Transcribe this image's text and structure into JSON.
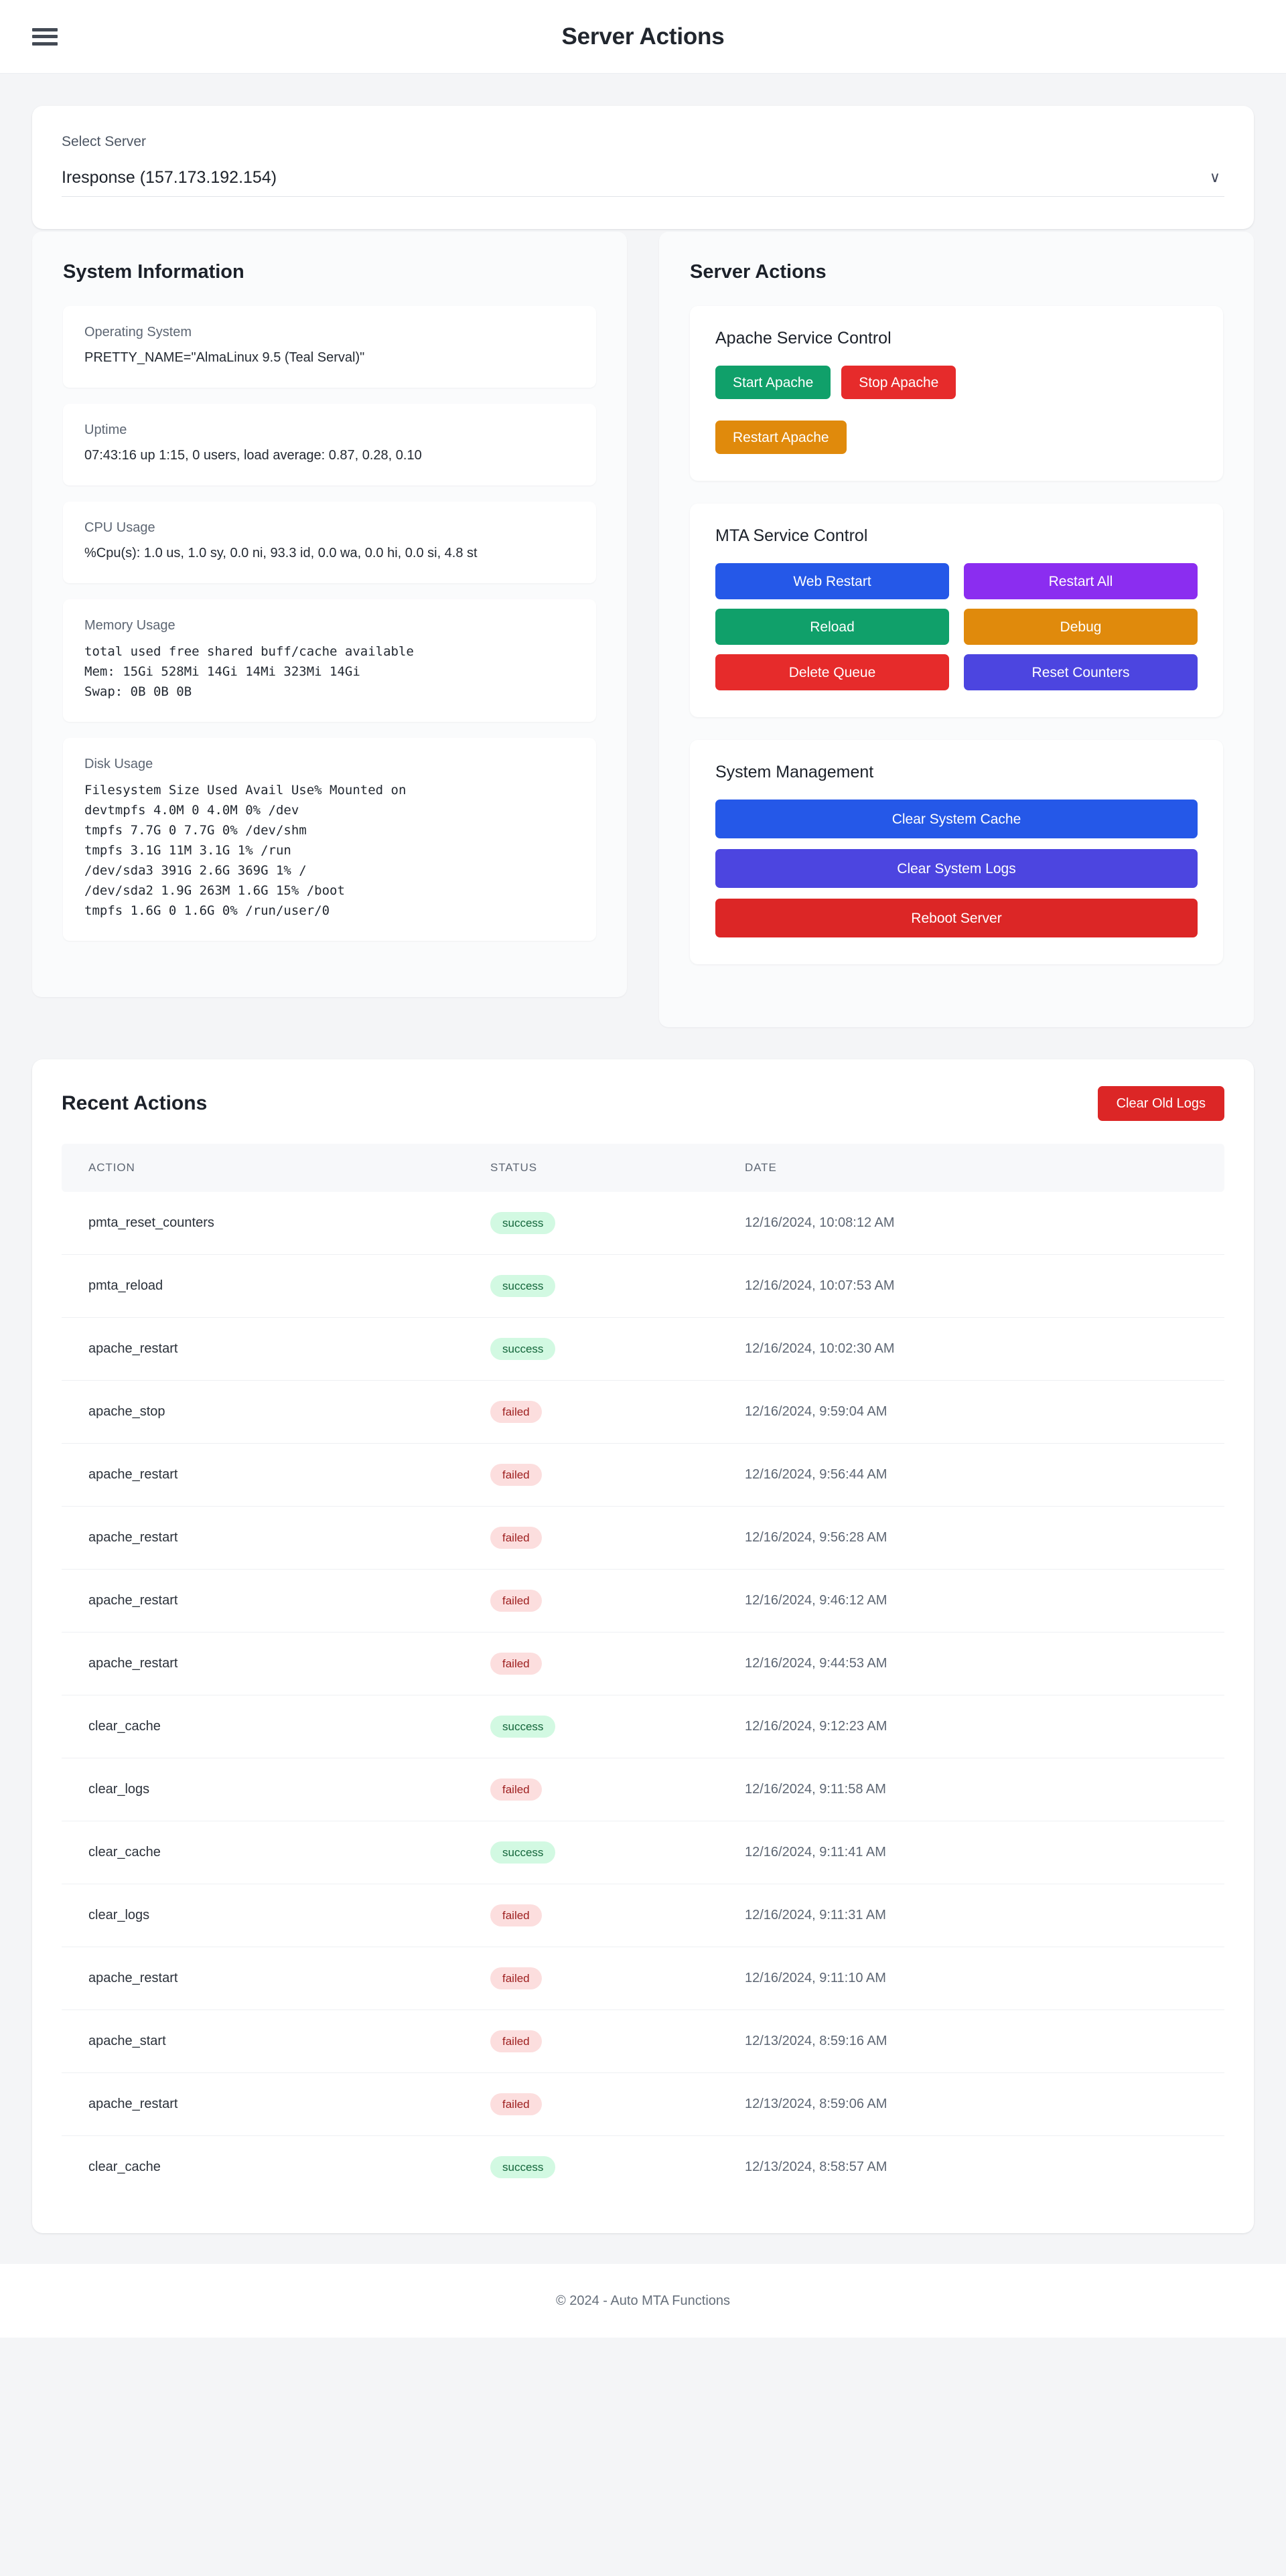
{
  "header": {
    "title": "Server Actions",
    "menu_icon": "hamburger-menu-icon"
  },
  "server_select": {
    "label": "Select Server",
    "value": "Iresponse (157.173.192.154)",
    "caret_icon": "chevron-down-icon"
  },
  "system_information": {
    "title": "System Information",
    "blocks": [
      {
        "label": "Operating System",
        "value": "PRETTY_NAME=\"AlmaLinux 9.5 (Teal Serval)\"",
        "mono": false
      },
      {
        "label": "Uptime",
        "value": "07:43:16 up 1:15, 0 users, load average: 0.87, 0.28, 0.10",
        "mono": false
      },
      {
        "label": "CPU Usage",
        "value": "%Cpu(s): 1.0 us, 1.0 sy, 0.0 ni, 93.3 id, 0.0 wa, 0.0 hi, 0.0 si, 4.8 st",
        "mono": false
      },
      {
        "label": "Memory Usage",
        "value": "total used free shared buff/cache available\nMem: 15Gi 528Mi 14Gi 14Mi 323Mi 14Gi\nSwap: 0B 0B 0B",
        "mono": true
      },
      {
        "label": "Disk Usage",
        "value": "Filesystem Size Used Avail Use% Mounted on\ndevtmpfs 4.0M 0 4.0M 0% /dev\ntmpfs 7.7G 0 7.7G 0% /dev/shm\ntmpfs 3.1G 11M 3.1G 1% /run\n/dev/sda3 391G 2.6G 369G 1% /\n/dev/sda2 1.9G 263M 1.6G 15% /boot\ntmpfs 1.6G 0 1.6G 0% /run/user/0",
        "mono": true
      }
    ]
  },
  "server_actions": {
    "title": "Server Actions",
    "apache": {
      "title": "Apache Service Control",
      "buttons": [
        {
          "label": "Start Apache",
          "color": "#10a06a"
        },
        {
          "label": "Stop Apache",
          "color": "#e62b2b"
        },
        {
          "label": "Restart Apache",
          "color": "#e08a0c"
        }
      ]
    },
    "mta": {
      "title": "MTA Service Control",
      "buttons": [
        {
          "label": "Web Restart",
          "color": "#2558e8"
        },
        {
          "label": "Restart All",
          "color": "#8b2df0"
        },
        {
          "label": "Reload",
          "color": "#10a06a"
        },
        {
          "label": "Debug",
          "color": "#e08a0c"
        },
        {
          "label": "Delete Queue",
          "color": "#e62b2b"
        },
        {
          "label": "Reset Counters",
          "color": "#4c45e0"
        }
      ]
    },
    "system_management": {
      "title": "System Management",
      "buttons": [
        {
          "label": "Clear System Cache",
          "color": "#2558e8"
        },
        {
          "label": "Clear System Logs",
          "color": "#4c45e0"
        },
        {
          "label": "Reboot Server",
          "color": "#dc2626"
        }
      ]
    }
  },
  "recent_actions": {
    "title": "Recent Actions",
    "clear_logs_label": "Clear Old Logs",
    "columns": [
      "ACTION",
      "STATUS",
      "DATE"
    ],
    "rows": [
      {
        "action": "pmta_reset_counters",
        "status": "success",
        "date": "12/16/2024, 10:08:12 AM"
      },
      {
        "action": "pmta_reload",
        "status": "success",
        "date": "12/16/2024, 10:07:53 AM"
      },
      {
        "action": "apache_restart",
        "status": "success",
        "date": "12/16/2024, 10:02:30 AM"
      },
      {
        "action": "apache_stop",
        "status": "failed",
        "date": "12/16/2024, 9:59:04 AM"
      },
      {
        "action": "apache_restart",
        "status": "failed",
        "date": "12/16/2024, 9:56:44 AM"
      },
      {
        "action": "apache_restart",
        "status": "failed",
        "date": "12/16/2024, 9:56:28 AM"
      },
      {
        "action": "apache_restart",
        "status": "failed",
        "date": "12/16/2024, 9:46:12 AM"
      },
      {
        "action": "apache_restart",
        "status": "failed",
        "date": "12/16/2024, 9:44:53 AM"
      },
      {
        "action": "clear_cache",
        "status": "success",
        "date": "12/16/2024, 9:12:23 AM"
      },
      {
        "action": "clear_logs",
        "status": "failed",
        "date": "12/16/2024, 9:11:58 AM"
      },
      {
        "action": "clear_cache",
        "status": "success",
        "date": "12/16/2024, 9:11:41 AM"
      },
      {
        "action": "clear_logs",
        "status": "failed",
        "date": "12/16/2024, 9:11:31 AM"
      },
      {
        "action": "apache_restart",
        "status": "failed",
        "date": "12/16/2024, 9:11:10 AM"
      },
      {
        "action": "apache_start",
        "status": "failed",
        "date": "12/13/2024, 8:59:16 AM"
      },
      {
        "action": "apache_restart",
        "status": "failed",
        "date": "12/13/2024, 8:59:06 AM"
      },
      {
        "action": "clear_cache",
        "status": "success",
        "date": "12/13/2024, 8:58:57 AM"
      }
    ]
  },
  "footer": {
    "text": "© 2024 - Auto MTA Functions"
  },
  "theme": {
    "page_bg": "#f4f5f7",
    "card_bg": "#ffffff",
    "panel_bg": "#fafbfc",
    "text": "#1c212a",
    "muted": "#5d6673",
    "success_bg": "#d2f9e2",
    "success_fg": "#14663b",
    "failed_bg": "#fcdede",
    "failed_fg": "#9e2020"
  }
}
